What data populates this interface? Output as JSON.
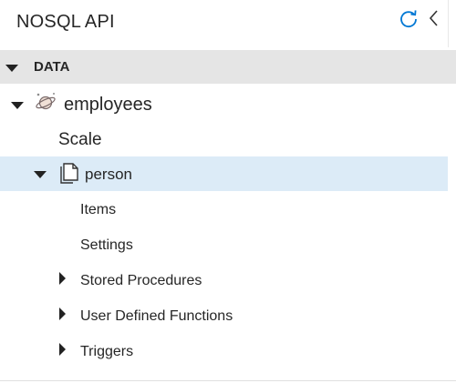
{
  "header": {
    "title": "NOSQL API"
  },
  "tree": {
    "section_label": "DATA",
    "database": {
      "label": "employees",
      "icon": "cosmos-database-icon"
    },
    "scale_label": "Scale",
    "container": {
      "label": "person",
      "icon": "document-collection-icon",
      "selected": true
    },
    "children": {
      "items": "Items",
      "settings": "Settings",
      "stored_procedures": "Stored Procedures",
      "user_defined_functions": "User Defined Functions",
      "triggers": "Triggers"
    }
  },
  "colors": {
    "selected_row": "#dcebf7",
    "section_header": "#e5e5e5",
    "accent": "#0078d4",
    "text": "#262626"
  }
}
